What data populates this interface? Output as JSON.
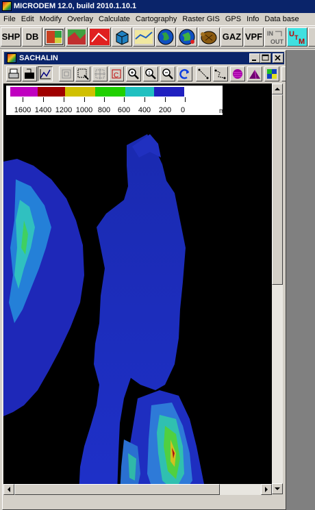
{
  "app": {
    "title": "MICRODEM 12.0, build 2010.1.10.1"
  },
  "menu": [
    "File",
    "Edit",
    "Modify",
    "Overlay",
    "Calculate",
    "Cartography",
    "Raster GIS",
    "GPS",
    "Info",
    "Data base"
  ],
  "toolbar": {
    "shp_label": "SHP",
    "db_label": "DB",
    "gaz_label": "GAZ",
    "vpf_label": "VPF"
  },
  "window": {
    "title": "SACHALIN"
  },
  "legend": {
    "colors": [
      "#c000c0",
      "#a00000",
      "#d0c000",
      "#20d000",
      "#20c0c0",
      "#2020c0",
      "#000080"
    ],
    "labels": [
      "1600",
      "1400",
      "1200",
      "1000",
      "800",
      "600",
      "400",
      "200",
      "0"
    ],
    "unit": "m"
  }
}
